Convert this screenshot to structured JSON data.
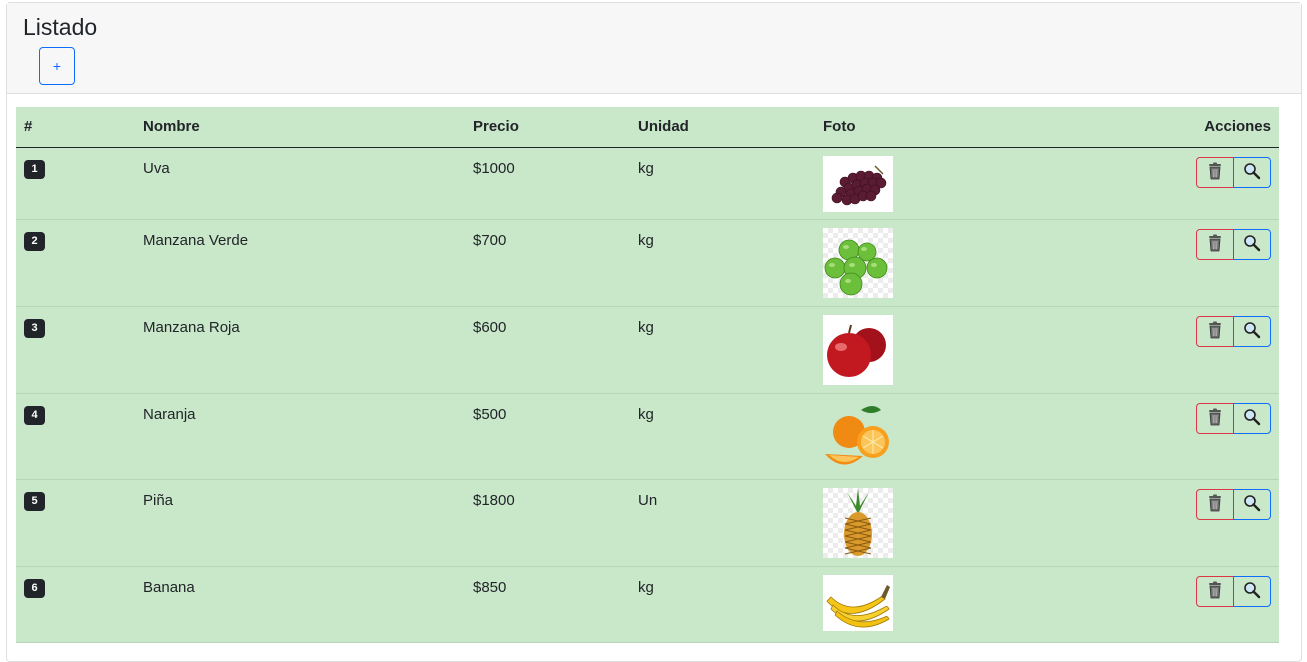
{
  "header": {
    "title": "Listado",
    "add_label": "+"
  },
  "table": {
    "columns": [
      "#",
      "Nombre",
      "Precio",
      "Unidad",
      "Foto",
      "Acciones"
    ],
    "rows": [
      {
        "num": "1",
        "nombre": "Uva",
        "precio": "$1000",
        "unidad": "kg",
        "foto": "grapes-photo",
        "height": 72
      },
      {
        "num": "2",
        "nombre": "Manzana Verde",
        "precio": "$700",
        "unidad": "kg",
        "foto": "green-apples-photo",
        "height": 87
      },
      {
        "num": "3",
        "nombre": "Manzana Roja",
        "precio": "$600",
        "unidad": "kg",
        "foto": "red-apples-photo",
        "height": 87
      },
      {
        "num": "4",
        "nombre": "Naranja",
        "precio": "$500",
        "unidad": "kg",
        "foto": "oranges-photo",
        "height": 86
      },
      {
        "num": "5",
        "nombre": "Piña",
        "precio": "$1800",
        "unidad": "Un",
        "foto": "pineapple-photo",
        "height": 87
      },
      {
        "num": "6",
        "nombre": "Banana",
        "precio": "$850",
        "unidad": "kg",
        "foto": "bananas-photo",
        "height": 76
      }
    ]
  },
  "actions": {
    "delete_icon": "trash-icon",
    "view_icon": "magnifier-icon"
  },
  "colors": {
    "row_bg": "#c9e7c9",
    "badge_bg": "#212529",
    "primary": "#0d6efd",
    "danger": "#dc3545"
  }
}
